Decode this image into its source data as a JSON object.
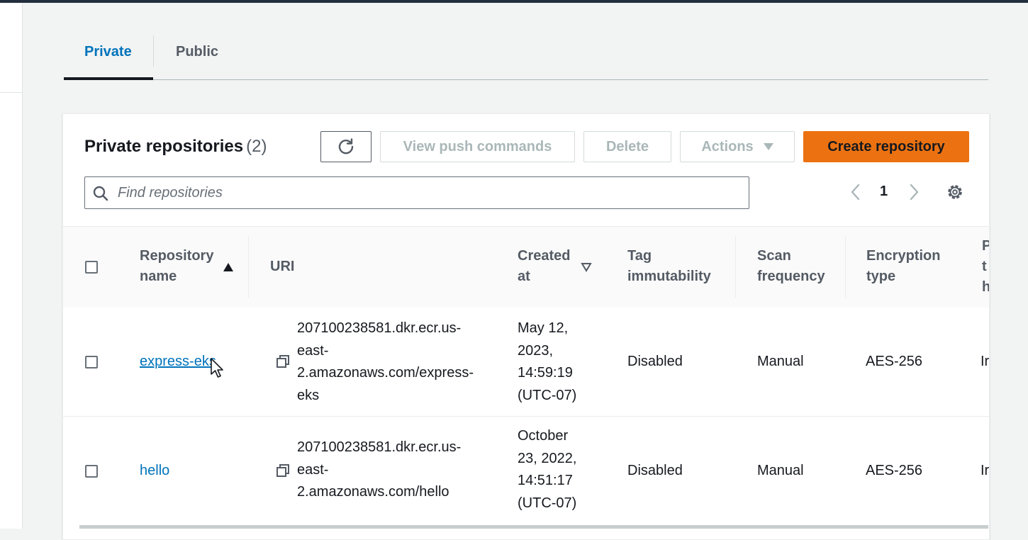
{
  "tabs": [
    {
      "label": "Private",
      "active": true
    },
    {
      "label": "Public",
      "active": false
    }
  ],
  "panel": {
    "title": "Private repositories",
    "count": "(2)"
  },
  "toolbar": {
    "refresh_icon": "refresh-icon",
    "view_push_label": "View push commands",
    "delete_label": "Delete",
    "actions_label": "Actions",
    "create_label": "Create repository"
  },
  "search": {
    "placeholder": "Find repositories",
    "value": ""
  },
  "pagination": {
    "current_page": "1"
  },
  "table": {
    "columns": {
      "name": [
        "Repository",
        "name"
      ],
      "uri": [
        "URI"
      ],
      "created": [
        "Created",
        "at"
      ],
      "tag": [
        "Tag",
        "immutability"
      ],
      "scan": [
        "Scan",
        "frequency"
      ],
      "enc": [
        "Encryption",
        "type"
      ],
      "partial": [
        "P",
        "t",
        "h"
      ]
    },
    "rows": [
      {
        "name": "express-eks",
        "uri": [
          "207100238581.dkr.ecr.us-",
          "east-",
          "2.amazonaws.com/express-",
          "eks"
        ],
        "created": [
          "May 12,",
          "2023,",
          "14:59:19",
          "(UTC-07)"
        ],
        "tag_immutability": "Disabled",
        "scan_frequency": "Manual",
        "encryption_type": "AES-256",
        "partial": "Ir"
      },
      {
        "name": "hello",
        "uri": [
          "207100238581.dkr.ecr.us-",
          "east-",
          "2.amazonaws.com/hello"
        ],
        "created": [
          "October",
          "23, 2022,",
          "14:51:17",
          "(UTC-07)"
        ],
        "tag_immutability": "Disabled",
        "scan_frequency": "Manual",
        "encryption_type": "AES-256",
        "partial": "Ir"
      }
    ]
  },
  "colors": {
    "accent": "#0073bb",
    "primary_button": "#ec7211",
    "text": "#16191f",
    "muted": "#545b64"
  }
}
